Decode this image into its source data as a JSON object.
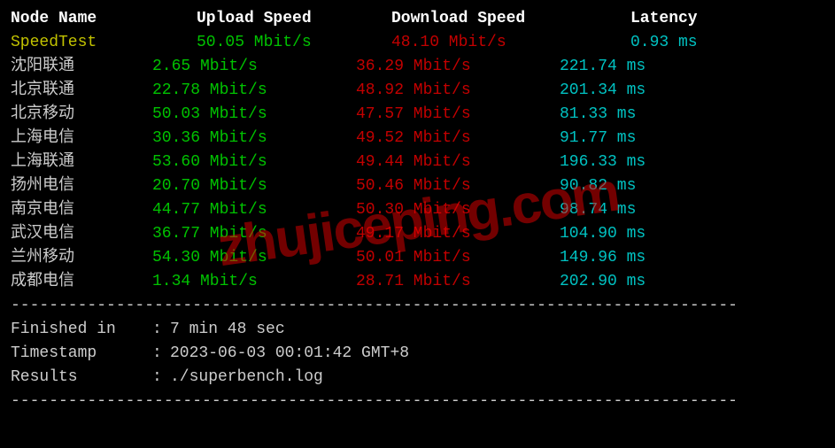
{
  "headers": {
    "node": "Node Name",
    "upload": "Upload Speed",
    "download": "Download Speed",
    "latency": "Latency"
  },
  "speedtest": {
    "node": "SpeedTest",
    "upload": "50.05 Mbit/s",
    "download": "48.10 Mbit/s",
    "latency": "0.93 ms"
  },
  "rows": [
    {
      "node": "沈阳联通",
      "upload": "2.65 Mbit/s",
      "download": "36.29 Mbit/s",
      "latency": "221.74 ms"
    },
    {
      "node": "北京联通",
      "upload": "22.78 Mbit/s",
      "download": "48.92 Mbit/s",
      "latency": "201.34 ms"
    },
    {
      "node": "北京移动",
      "upload": "50.03 Mbit/s",
      "download": "47.57 Mbit/s",
      "latency": "81.33 ms"
    },
    {
      "node": "上海电信",
      "upload": "30.36 Mbit/s",
      "download": "49.52 Mbit/s",
      "latency": "91.77 ms"
    },
    {
      "node": "上海联通",
      "upload": "53.60 Mbit/s",
      "download": "49.44 Mbit/s",
      "latency": "196.33 ms"
    },
    {
      "node": "扬州电信",
      "upload": "20.70 Mbit/s",
      "download": "50.46 Mbit/s",
      "latency": "90.82 ms"
    },
    {
      "node": "南京电信",
      "upload": "44.77 Mbit/s",
      "download": "50.30 Mbit/s",
      "latency": "98.74 ms"
    },
    {
      "node": "武汉电信",
      "upload": "36.77 Mbit/s",
      "download": "49.17 Mbit/s",
      "latency": "104.90 ms"
    },
    {
      "node": "兰州移动",
      "upload": "54.30 Mbit/s",
      "download": "50.01 Mbit/s",
      "latency": "149.96 ms"
    },
    {
      "node": "成都电信",
      "upload": "1.34 Mbit/s",
      "download": "28.71 Mbit/s",
      "latency": "202.90 ms"
    }
  ],
  "divider": "----------------------------------------------------------------------------",
  "footer": {
    "finished_label": "Finished in",
    "finished_value": "7 min 48 sec",
    "timestamp_label": "Timestamp",
    "timestamp_value": "2023-06-03 00:01:42 GMT+8",
    "results_label": "Results",
    "results_value": "./superbench.log"
  },
  "watermark": "zhujiceping.com"
}
